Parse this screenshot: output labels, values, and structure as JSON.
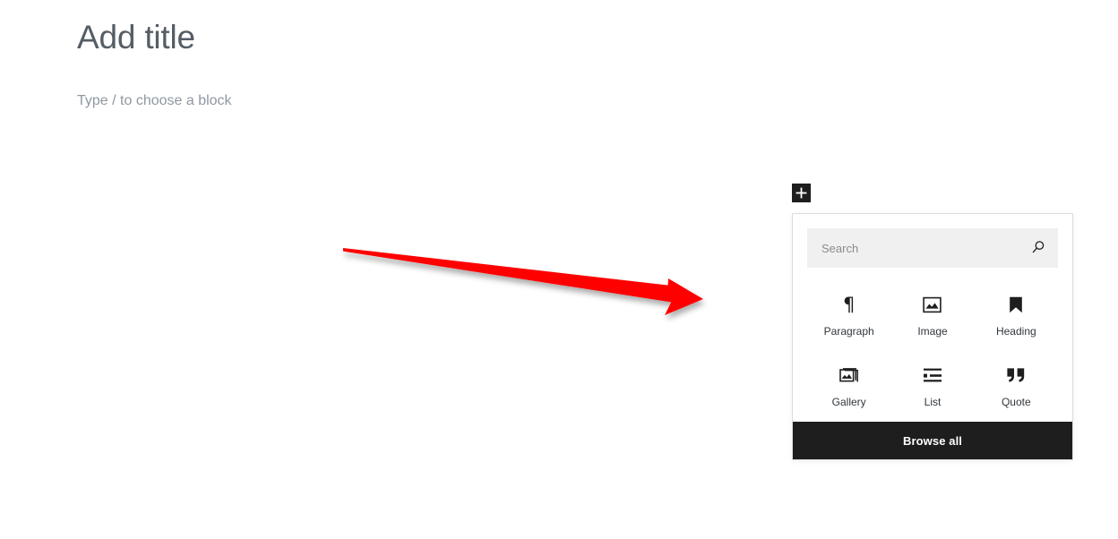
{
  "editor": {
    "title_placeholder": "Add title",
    "block_placeholder": "Type / to choose a block"
  },
  "inserter": {
    "toggle_label": "+",
    "toggle_icon": "plus-icon",
    "search": {
      "placeholder": "Search",
      "value": "",
      "icon": "search-icon"
    },
    "blocks": [
      {
        "label": "Paragraph",
        "icon": "paragraph-pilcrow-icon"
      },
      {
        "label": "Image",
        "icon": "image-icon"
      },
      {
        "label": "Heading",
        "icon": "heading-bookmark-icon"
      },
      {
        "label": "Gallery",
        "icon": "gallery-stacked-images-icon"
      },
      {
        "label": "List",
        "icon": "list-bullet-icon"
      },
      {
        "label": "Quote",
        "icon": "quote-marks-icon"
      }
    ],
    "browse_all_label": "Browse all"
  },
  "annotation": {
    "type": "arrow",
    "color": "#ff0000",
    "points_to": "inserter-popover",
    "direction": "right-down"
  },
  "colors": {
    "page_background": "#ffffff",
    "title_text": "#555d66",
    "placeholder_text": "#8f98a1",
    "panel_border": "#dcdcde",
    "search_background": "#f0f0f0",
    "accent_dark": "#1e1e1e",
    "annotation_red": "#ff0000"
  }
}
